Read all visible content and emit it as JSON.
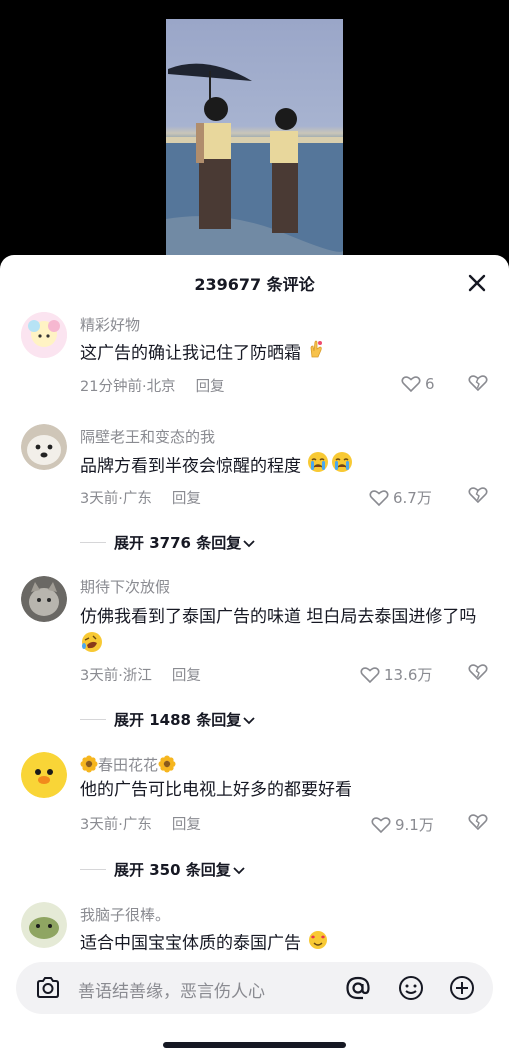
{
  "header": {
    "title": "239677 条评论"
  },
  "comments": [
    {
      "username": "精彩好物",
      "text": "这广告的确让我记住了防晒霜",
      "time": "21分钟前",
      "location": "北京",
      "reply": "回复",
      "likes": "6"
    },
    {
      "username": "隔壁老王和变态的我",
      "text": "品牌方看到半夜会惊醒的程度",
      "time": "3天前",
      "location": "广东",
      "reply": "回复",
      "likes": "6.7万",
      "expand": "展开 3776 条回复"
    },
    {
      "username": "期待下次放假",
      "text": "仿佛我看到了泰国广告的味道 坦白局去泰国进修了吗",
      "time": "3天前",
      "location": "浙江",
      "reply": "回复",
      "likes": "13.6万",
      "expand": "展开 1488 条回复"
    },
    {
      "username": "春田花花",
      "text": "他的广告可比电视上好多的都要好看",
      "time": "3天前",
      "location": "广东",
      "reply": "回复",
      "likes": "9.1万",
      "expand": "展开 350 条回复"
    },
    {
      "username": "我脑子很棒。",
      "text": "适合中国宝宝体质的泰国广告"
    }
  ],
  "separator": "·",
  "input": {
    "placeholder": "善语结善缘，恶言伤人心"
  },
  "icons": [
    "close-icon",
    "heart-icon",
    "broken-heart-icon",
    "camera-icon",
    "at-icon",
    "emoji-icon",
    "plus-icon",
    "chevron-down-icon"
  ]
}
